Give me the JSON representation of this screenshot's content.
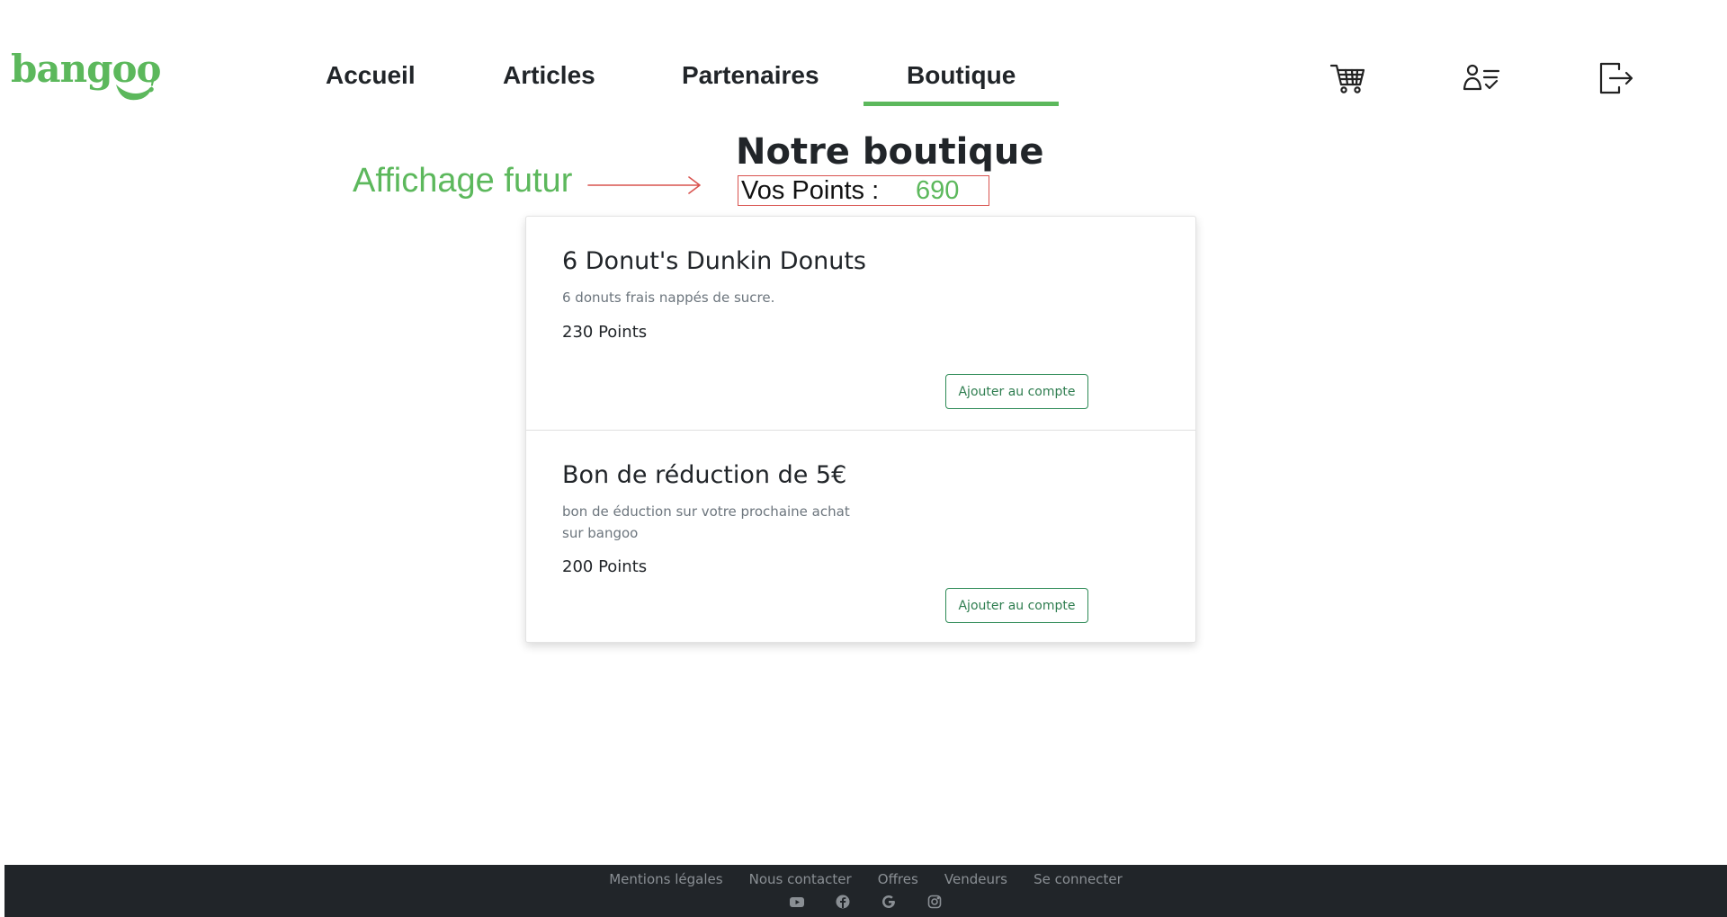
{
  "brand": {
    "name": "bangoo",
    "accent": "#5cb85c"
  },
  "nav": {
    "items": [
      {
        "label": "Accueil"
      },
      {
        "label": "Articles"
      },
      {
        "label": "Partenaires"
      },
      {
        "label": "Boutique",
        "active": true
      }
    ]
  },
  "header_icons": [
    "cart-icon",
    "user-list-icon",
    "logout-icon"
  ],
  "annotation": {
    "text": "Affichage futur"
  },
  "page": {
    "title": "Notre boutique",
    "points_label": "Vos Points :",
    "points_value": "690"
  },
  "products": [
    {
      "title": "6 Donut's Dunkin Donuts",
      "description": "6 donuts frais nappés de sucre.",
      "points": "230 Points",
      "button": "Ajouter au compte"
    },
    {
      "title": "Bon de réduction de 5€",
      "description": "bon de éduction sur votre prochaine achat sur bangoo",
      "points": "200 Points",
      "button": "Ajouter au compte"
    }
  ],
  "footer": {
    "links": [
      "Mentions légales",
      "Nous contacter",
      "Offres",
      "Vendeurs",
      "Se connecter"
    ],
    "social_icons": [
      "youtube-icon",
      "facebook-icon",
      "google-icon",
      "instagram-icon"
    ],
    "background": "#212529"
  }
}
